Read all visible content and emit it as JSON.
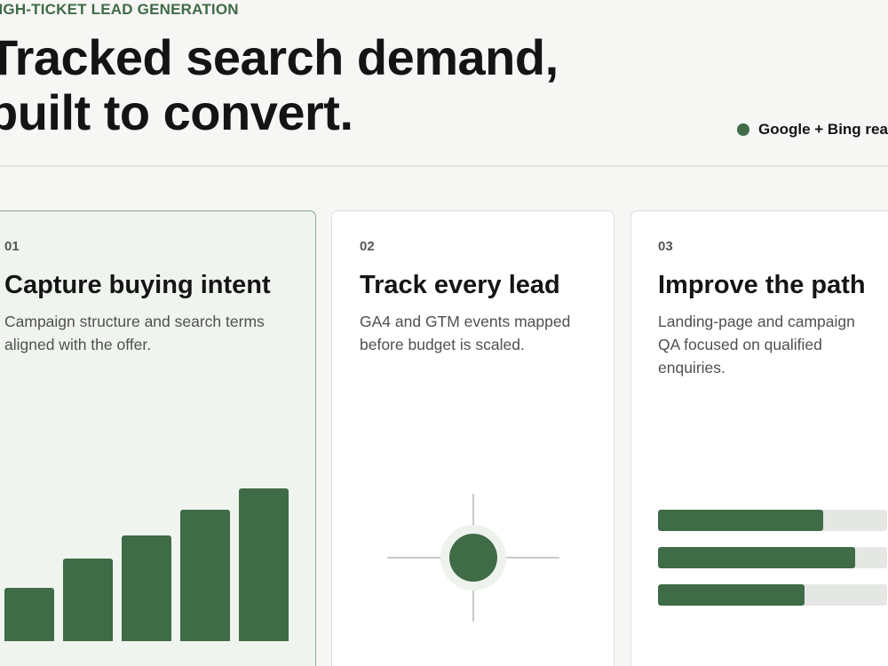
{
  "hero": {
    "eyebrow": "HIGH-TICKET LEAD GENERATION",
    "headline_line1": "Tracked search demand,",
    "headline_line2": "built to convert.",
    "status_label": "Google + Bing ready"
  },
  "cards": [
    {
      "number": "01",
      "title": "Capture buying intent",
      "description": "Campaign structure and search terms aligned with the offer.",
      "visual": "bar-chart-icon",
      "bar_levels": [
        0.35,
        0.54,
        0.69,
        0.86,
        1.0
      ]
    },
    {
      "number": "02",
      "title": "Track every lead",
      "description": "GA4 and GTM events mapped before budget is scaled.",
      "visual": "crosshair-target-icon"
    },
    {
      "number": "03",
      "title": "Improve the path",
      "description": "Landing-page and campaign QA focused on qualified enquiries.",
      "visual": "progress-bars-icon",
      "progress": [
        0.72,
        0.86,
        0.64
      ]
    }
  ],
  "colors": {
    "accent": "#3f6b47",
    "active_card_bg": "#f0f4ef",
    "track": "#e5e7e4"
  }
}
